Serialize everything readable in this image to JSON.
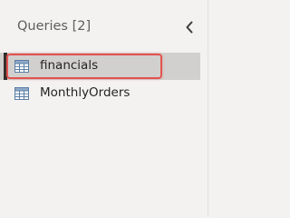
{
  "queries_pane": {
    "title": "Queries [2]",
    "collapse_icon": "chevron-left-icon",
    "items": [
      {
        "label": "financials",
        "icon": "table-icon",
        "selected": true,
        "highlighted": true
      },
      {
        "label": "MonthlyOrders",
        "icon": "table-icon",
        "selected": false,
        "highlighted": false
      }
    ]
  },
  "colors": {
    "pane_background": "#f3f2f1",
    "selected_background": "#d2d0ce",
    "highlight_border": "#e0534f",
    "icon_blue": "#5b7fa6"
  }
}
